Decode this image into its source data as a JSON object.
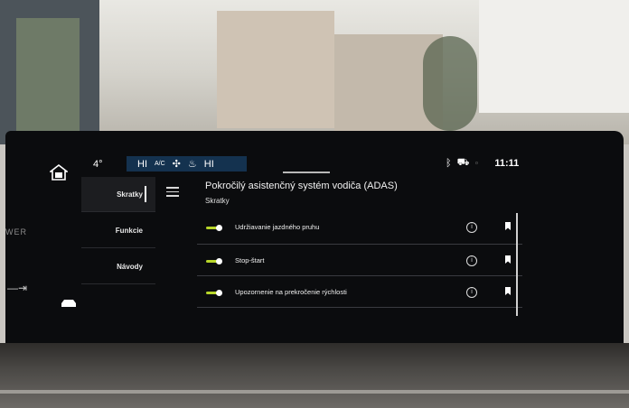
{
  "topbar": {
    "temperature": "4°",
    "climate": {
      "left_temp": "HI",
      "ac_label": "A/C",
      "right_temp": "HI"
    },
    "status": {
      "time": "11:11"
    }
  },
  "left_panel": {
    "power_label": "WER"
  },
  "nav": {
    "items": [
      {
        "label": "Skratky",
        "active": true
      },
      {
        "label": "Funkcie",
        "active": false
      },
      {
        "label": "Návody",
        "active": false
      }
    ]
  },
  "content": {
    "title": "Pokročilý asistenčný systém vodiča (ADAS)",
    "subtitle": "Skratky",
    "rows": [
      {
        "label": "Udržiavanie jazdného pruhu",
        "toggle_on": true
      },
      {
        "label": "Stop-štart",
        "toggle_on": true
      },
      {
        "label": "Upozornenie na prekročenie rýchlosti",
        "toggle_on": true
      }
    ]
  },
  "colors": {
    "accent": "#b8d62a",
    "climate_bar": "#14324f"
  }
}
